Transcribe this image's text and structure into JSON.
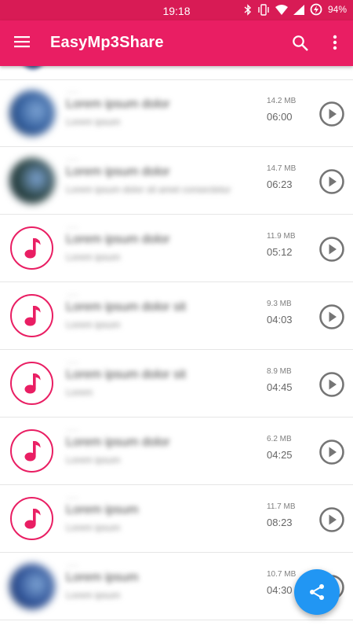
{
  "status_bar": {
    "time": "19:18",
    "battery": "94%"
  },
  "app_bar": {
    "title": "EasyMp3Share"
  },
  "colors": {
    "accent": "#e91e63",
    "status_bar": "#d81b55",
    "fab": "#2196f3"
  },
  "tracks": [
    {
      "thumb": "photo",
      "thumb_color": "#2f5a99",
      "title": "Lorem ipsum dolor",
      "artist": "Lorem ipsum",
      "size": "14.2 MB",
      "duration": "06:00"
    },
    {
      "thumb": "photo",
      "thumb_color": "#27403e",
      "title": "Lorem ipsum dolor",
      "artist": "Lorem ipsum dolor sit amet consectetur",
      "size": "14.7 MB",
      "duration": "06:23"
    },
    {
      "thumb": "note",
      "title": "Lorem ipsum dolor",
      "artist": "Lorem ipsum",
      "size": "11.9 MB",
      "duration": "05:12"
    },
    {
      "thumb": "note",
      "title": "Lorem ipsum dolor sit",
      "artist": "Lorem ipsum",
      "size": "9.3 MB",
      "duration": "04:03"
    },
    {
      "thumb": "note",
      "title": "Lorem ipsum dolor sit",
      "artist": "Lorem",
      "size": "8.9 MB",
      "duration": "04:45"
    },
    {
      "thumb": "note",
      "title": "Lorem ipsum dolor",
      "artist": "Lorem ipsum",
      "size": "6.2 MB",
      "duration": "04:25"
    },
    {
      "thumb": "note",
      "title": "Lorem ipsum",
      "artist": "Lorem ipsum",
      "size": "11.7 MB",
      "duration": "08:23"
    },
    {
      "thumb": "photo",
      "thumb_color": "#2c4f94",
      "title": "Lorem ipsum",
      "artist": "Lorem ipsum",
      "size": "10.7 MB",
      "duration": "04:30"
    }
  ],
  "icons": {
    "menu": "menu-icon",
    "search": "search-icon",
    "more": "more-vert-icon",
    "play": "play-circle-icon",
    "note": "music-note-icon",
    "share": "share-icon"
  }
}
